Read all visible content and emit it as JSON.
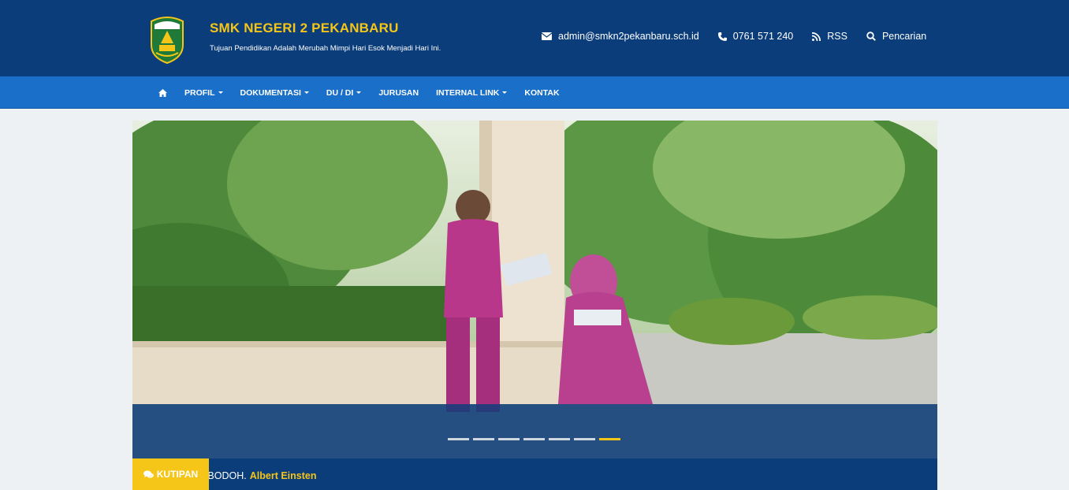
{
  "header": {
    "title": "SMK NEGERI 2 PEKANBARU",
    "tagline": "Tujuan Pendidikan Adalah Merubah Mimpi Hari Esok Menjadi Hari Ini.",
    "contacts": {
      "email": "admin@smkn2pekanbaru.sch.id",
      "phone": "0761 571 240",
      "rss": "RSS",
      "search": "Pencarian"
    }
  },
  "nav": {
    "items": [
      "PROFIL",
      "DOKUMENTASI",
      "DU / DI",
      "JURUSAN",
      "INTERNAL LINK",
      "KONTAK"
    ]
  },
  "slider": {
    "indicator_count": 7,
    "active_index": 6
  },
  "quote": {
    "label": "KUTIPAN",
    "text": "a BODOH.",
    "author": "Albert Einsten"
  },
  "colors": {
    "primary": "#0b3d7a",
    "nav": "#1a6fc9",
    "accent": "#f5c518"
  }
}
